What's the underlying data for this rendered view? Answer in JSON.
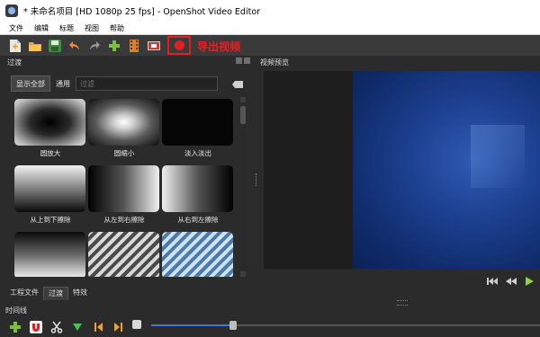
{
  "window": {
    "title": "* 未命名项目 [HD 1080p 25 fps] - OpenShot Video Editor"
  },
  "menu": [
    "文件",
    "编辑",
    "标题",
    "视图",
    "帮助"
  ],
  "toolbar": {
    "export_label": "导出视频"
  },
  "transitions_panel": {
    "title": "过渡",
    "show_all_button": "显示全部",
    "common_label": "通用",
    "filter_placeholder": "过滤",
    "items": [
      {
        "label": "圆放大"
      },
      {
        "label": "圆缩小"
      },
      {
        "label": "淡入淡出"
      },
      {
        "label": "从上到下擦除"
      },
      {
        "label": "从左到右擦除"
      },
      {
        "label": "从右到左擦除"
      }
    ]
  },
  "preview_panel": {
    "title": "视频预览"
  },
  "bottom_tabs": [
    "工程文件",
    "过渡",
    "特效"
  ],
  "timeline": {
    "title": "时间线"
  },
  "colors": {
    "accent": "#e02020",
    "zoom_track": "#3d7ad6",
    "preview_background": "#1c3f8f"
  }
}
